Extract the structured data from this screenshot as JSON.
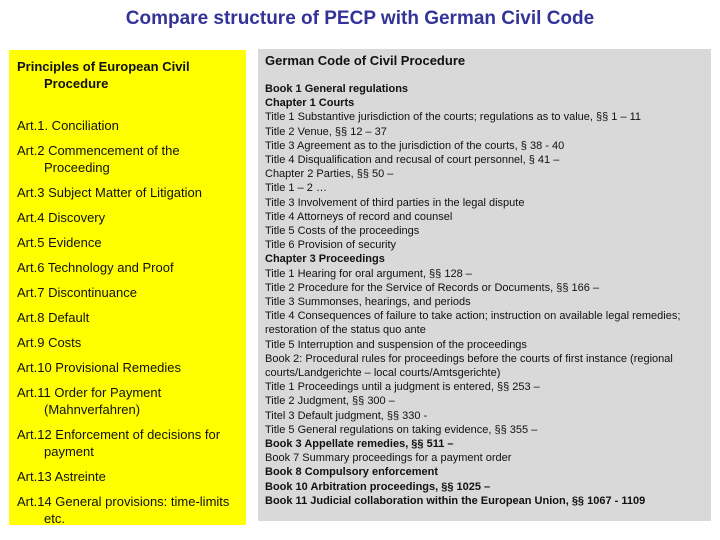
{
  "title": "Compare structure of PECP with German Civil Code",
  "colors": {
    "title": "#333399",
    "left_box_bg": "#ffff00",
    "right_box_bg": "#d9d9d9"
  },
  "left_panel": {
    "heading": "Principles of European Civil Procedure",
    "items": [
      "Art.1. Conciliation",
      "Art.2 Commencement of the Proceeding",
      "Art.3 Subject Matter of Litigation",
      "Art.4 Discovery",
      "Art.5 Evidence",
      "Art.6 Technology and Proof",
      "Art.7 Discontinuance",
      "Art.8 Default",
      "Art.9 Costs",
      "Art.10 Provisional Remedies",
      "Art.11 Order for Payment (Mahnverfahren)",
      "Art.12 Enforcement of decisions for payment",
      "Art.13 Astreinte",
      "Art.14 General provisions: time-limits etc."
    ]
  },
  "right_panel": {
    "heading": "German Code of Civil Procedure",
    "lines": [
      {
        "text": "Book 1 General regulations",
        "bold": true
      },
      {
        "text": "Chapter 1 Courts",
        "bold": true
      },
      {
        "text": "Title 1 Substantive jurisdiction of the courts; regulations as to value, §§ 1 – 11",
        "bold": false
      },
      {
        "text": "Title 2 Venue, §§ 12 – 37",
        "bold": false
      },
      {
        "text": "Title 3 Agreement as to the jurisdiction of the courts, § 38 - 40",
        "bold": false
      },
      {
        "text": "Title 4 Disqualification and recusal of court personnel, § 41 –",
        "bold": false
      },
      {
        "text": "Chapter 2 Parties, §§ 50 –",
        "bold": false
      },
      {
        "text": "Title 1 – 2 …",
        "bold": false
      },
      {
        "text": "Title 3 Involvement of third parties in the legal dispute",
        "bold": false
      },
      {
        "text": "Title 4 Attorneys of record and counsel",
        "bold": false
      },
      {
        "text": "Title 5 Costs of the proceedings",
        "bold": false
      },
      {
        "text": "Title 6 Provision of security",
        "bold": false
      },
      {
        "text": "Chapter 3 Proceedings",
        "bold": true
      },
      {
        "text": "Title 1 Hearing for oral argument, §§ 128 –",
        "bold": false
      },
      {
        "text": "Title 2 Procedure for the Service of Records or Documents, §§ 166 –",
        "bold": false
      },
      {
        "text": "Title 3 Summonses, hearings, and periods",
        "bold": false
      },
      {
        "text": "Title 4 Consequences of failure to take action; instruction on available legal remedies; restoration of the status quo ante",
        "bold": false,
        "wrap": true
      },
      {
        "text": "Title 5 Interruption and suspension of the proceedings",
        "bold": false
      },
      {
        "text": "Book 2: Procedural rules for proceedings before the courts of first instance (regional courts/Landgerichte – local courts/Amtsgerichte)",
        "bold": false,
        "wrap": true
      },
      {
        "text": "Title 1 Proceedings until a judgment is entered, §§ 253 –",
        "bold": false
      },
      {
        "text": "Title 2 Judgment, §§ 300 –",
        "bold": false
      },
      {
        "text": "Titel 3 Default judgment, §§ 330 -",
        "bold": false
      },
      {
        "text": "Title 5 General regulations on taking evidence, §§ 355 –",
        "bold": false
      },
      {
        "text": "Book 3 Appellate remedies, §§ 511 –",
        "bold": true
      },
      {
        "text": "Book 7 Summary proceedings for a payment order",
        "bold": false
      },
      {
        "text": "Book 8 Compulsory enforcement",
        "bold": true
      },
      {
        "text": "Book 10 Arbitration proceedings, §§ 1025 –",
        "bold": true
      },
      {
        "text": "Book 11 Judicial collaboration within the European Union, §§ 1067 - 1109",
        "bold": true
      }
    ]
  }
}
